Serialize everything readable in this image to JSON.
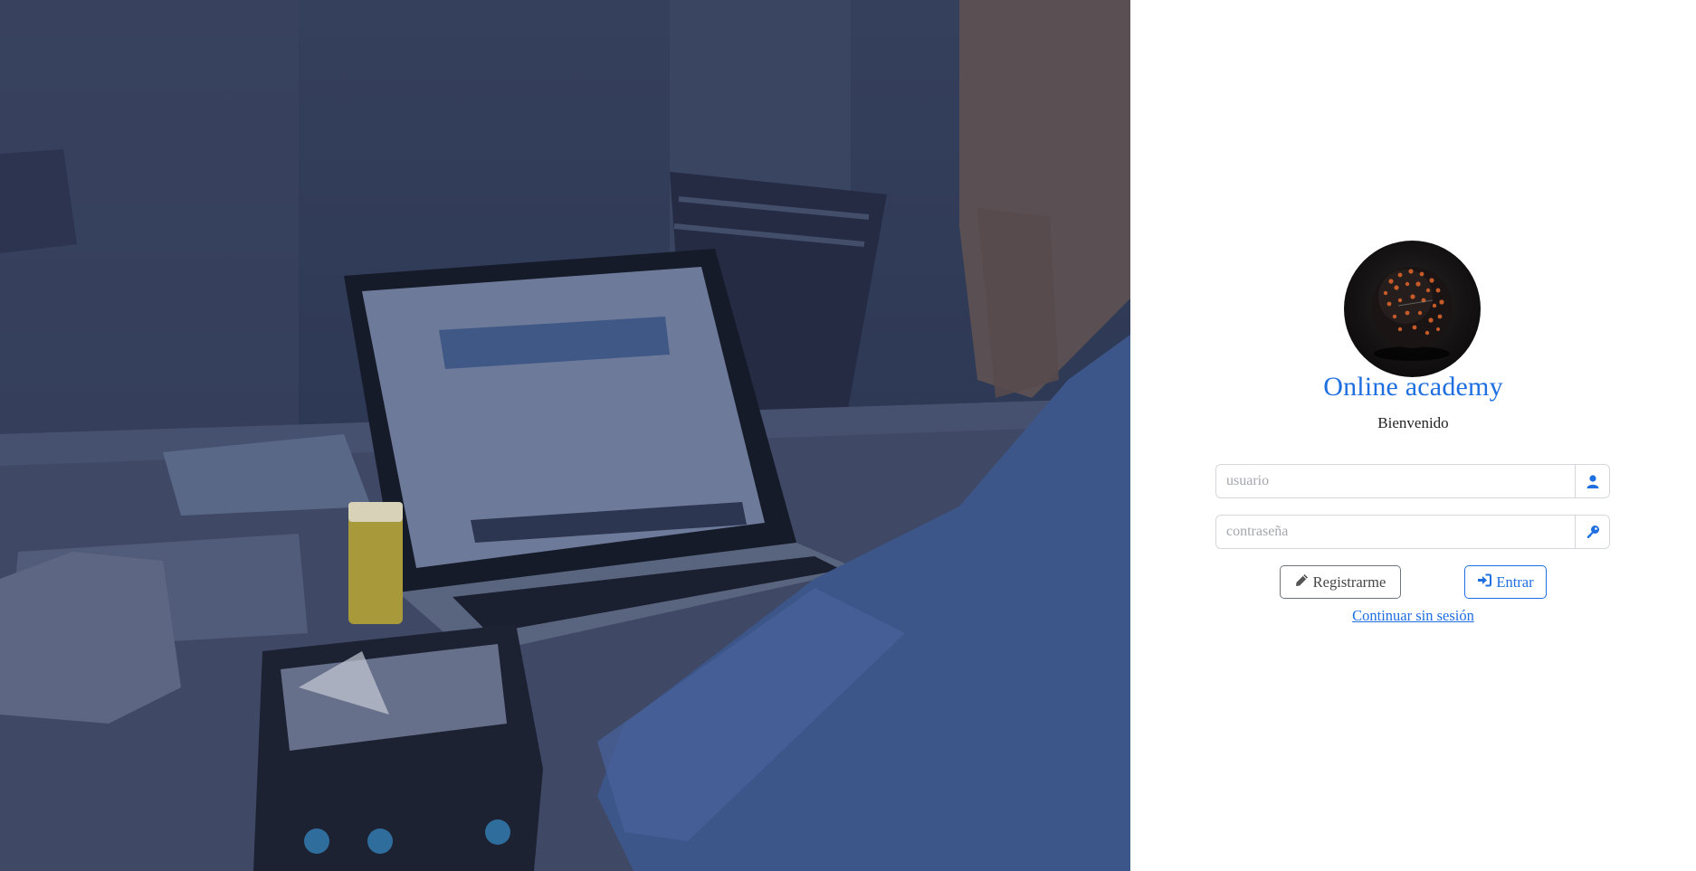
{
  "app": {
    "title": "Online academy",
    "welcome": "Bienvenido"
  },
  "hero": {
    "image": "students-laptop-photo"
  },
  "logo": {
    "icon": "sphere-logo"
  },
  "form": {
    "username": {
      "placeholder": "usuario",
      "value": "",
      "icon": "user-icon"
    },
    "password": {
      "placeholder": "contraseña",
      "value": "",
      "icon": "key-icon"
    }
  },
  "buttons": {
    "register": {
      "label": "Registrarme",
      "icon": "pencil-icon"
    },
    "login": {
      "label": "Entrar",
      "icon": "sign-in-icon"
    }
  },
  "links": {
    "guest": "Continuar sin sesión"
  },
  "colors": {
    "accent": "#1f6fe0",
    "secondary": "#6c757d",
    "overlay": "#2f3a56"
  }
}
